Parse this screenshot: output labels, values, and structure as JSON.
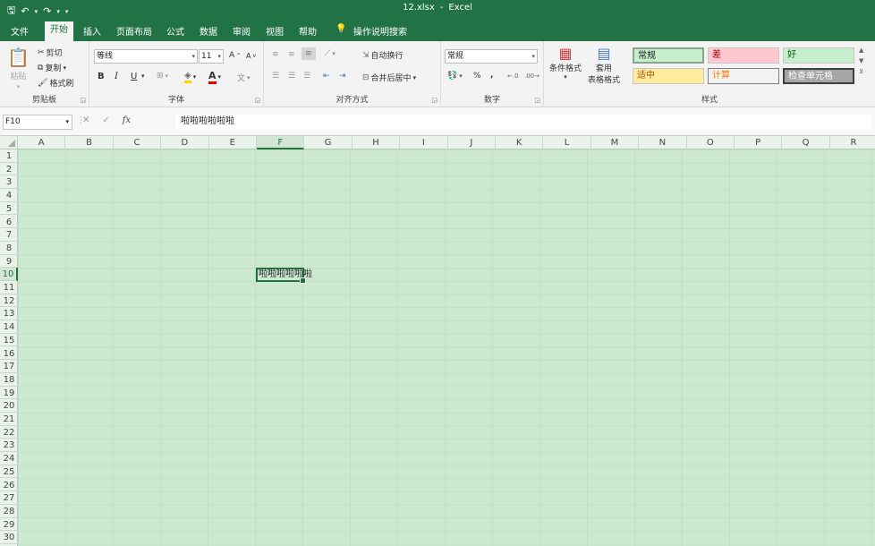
{
  "window": {
    "file_name": "12.xlsx",
    "separator": "-",
    "app_name": "Excel"
  },
  "qat": {
    "save": "🖫",
    "undo": "↶",
    "redo": "↷",
    "more": "▾"
  },
  "tabs": [
    "文件",
    "开始",
    "插入",
    "页面布局",
    "公式",
    "数据",
    "审阅",
    "视图",
    "帮助"
  ],
  "active_tab": "开始",
  "tell_me": "操作说明搜索",
  "ribbon": {
    "clipboard": {
      "paste": "粘贴",
      "cut": "剪切",
      "copy": "复制",
      "format_painter": "格式刷",
      "label": "剪贴板"
    },
    "font": {
      "name": "等线",
      "size": "11",
      "bold": "B",
      "italic": "I",
      "underline": "U",
      "grow": "A",
      "shrink": "A",
      "phonetic": "文",
      "label": "字体"
    },
    "alignment": {
      "wrap": "自动换行",
      "merge": "合并后居中",
      "label": "对齐方式"
    },
    "number": {
      "format": "常规",
      "percent": "%",
      "comma": ",",
      "label": "数字"
    },
    "styles": {
      "conditional": "条件格式",
      "table_line1": "套用",
      "table_line2": "表格格式",
      "normal": "常规",
      "bad": "差",
      "good": "好",
      "neutral": "适中",
      "calc": "计算",
      "check": "检查单元格",
      "label": "样式"
    }
  },
  "formula_bar": {
    "name_box": "F10",
    "cancel": "✕",
    "enter": "✓",
    "fx": "fx",
    "content": "啦啦啦啦啦啦"
  },
  "columns": [
    "A",
    "B",
    "C",
    "D",
    "E",
    "F",
    "G",
    "H",
    "I",
    "J",
    "K",
    "L",
    "M",
    "N",
    "O",
    "P",
    "Q",
    "R"
  ],
  "rows": [
    "1",
    "2",
    "3",
    "4",
    "5",
    "6",
    "7",
    "8",
    "9",
    "10",
    "11",
    "12",
    "13",
    "14",
    "15",
    "16",
    "17",
    "18",
    "19",
    "20",
    "21",
    "22",
    "23",
    "24",
    "25",
    "26",
    "27",
    "28",
    "29",
    "30"
  ],
  "active_cell": {
    "column": "F",
    "row": "10",
    "value": "啦啦啦啦啦啦"
  },
  "colors": {
    "accent": "#217346",
    "sheet_bg": "#cce8cf",
    "bad_bg": "#ffc7ce",
    "good_bg": "#c6efce",
    "neutral_bg": "#ffeb9c",
    "check_bg": "#a5a5a5"
  }
}
